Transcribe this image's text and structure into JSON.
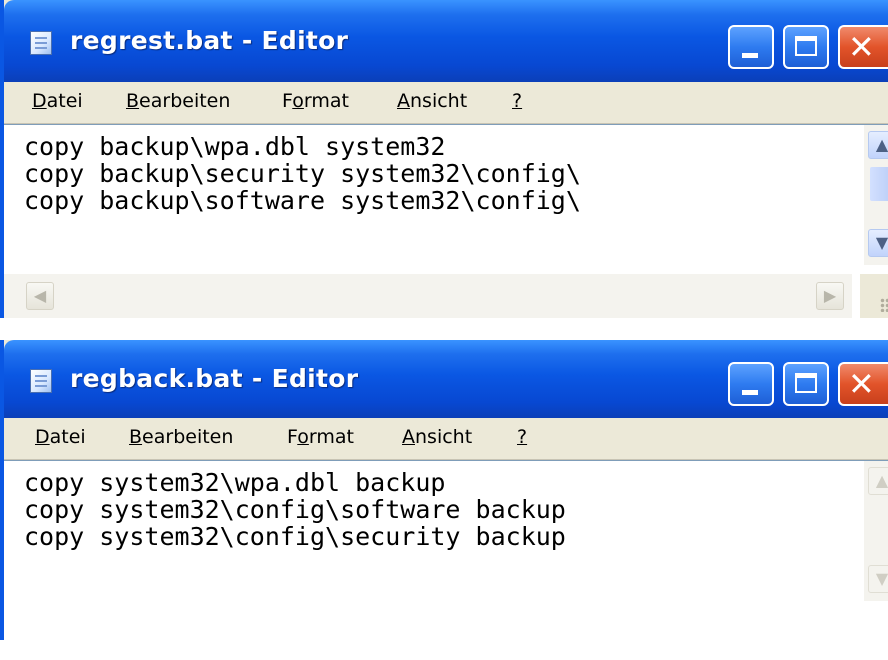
{
  "windows": [
    {
      "title": "regrest.bat - Editor",
      "menu": [
        {
          "label": "Datei",
          "key": "D",
          "rest": "atei"
        },
        {
          "label": "Bearbeiten",
          "key": "B",
          "rest": "earbeiten"
        },
        {
          "label": "Format",
          "key": "o",
          "pre": "F",
          "rest": "rmat"
        },
        {
          "label": "Ansicht",
          "key": "A",
          "rest": "nsicht"
        },
        {
          "label": "?",
          "key": "?",
          "rest": ""
        }
      ],
      "lines": [
        "copy backup\\wpa.dbl system32",
        "copy backup\\security system32\\config\\",
        "copy backup\\software system32\\config\\"
      ]
    },
    {
      "title": "regback.bat - Editor",
      "menu": [
        {
          "label": "Datei",
          "key": "D",
          "rest": "atei"
        },
        {
          "label": "Bearbeiten",
          "key": "B",
          "rest": "earbeiten"
        },
        {
          "label": "Format",
          "key": "o",
          "pre": "F",
          "rest": "rmat"
        },
        {
          "label": "Ansicht",
          "key": "A",
          "rest": "nsicht"
        },
        {
          "label": "?",
          "key": "?",
          "rest": ""
        }
      ],
      "lines": [
        "copy system32\\wpa.dbl backup",
        "copy system32\\config\\software backup",
        "copy system32\\config\\security backup"
      ]
    }
  ],
  "icons": {
    "app": "notepad-icon",
    "minimize": "minimize-icon",
    "maximize": "maximize-icon",
    "close": "close-icon",
    "scroll_up": "arrow-up-icon",
    "scroll_down": "arrow-down-icon",
    "scroll_left": "arrow-left-icon",
    "scroll_right": "arrow-right-icon"
  },
  "colors": {
    "titlebar": "#0a57e3",
    "close_button": "#e2542a",
    "menubar": "#ece9d8"
  }
}
